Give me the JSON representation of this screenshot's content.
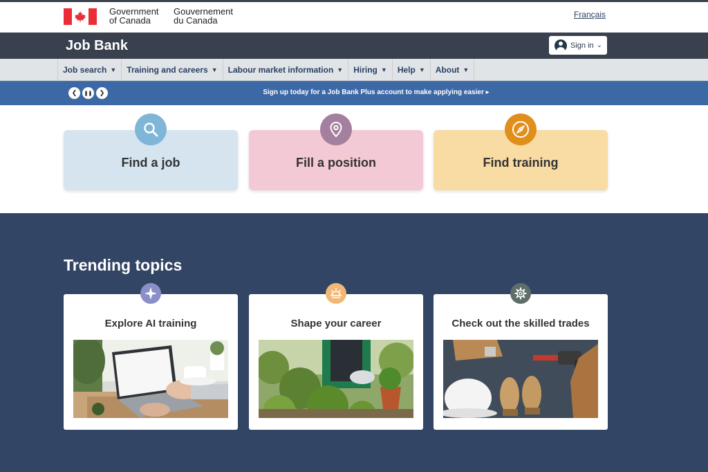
{
  "gc_header": {
    "signature_en_line1": "Government",
    "signature_en_line2": "of Canada",
    "signature_fr_line1": "Gouvernement",
    "signature_fr_line2": "du Canada",
    "language_toggle": "Français"
  },
  "app_bar": {
    "title": "Job Bank",
    "sign_in_label": "Sign in"
  },
  "menu": {
    "items": [
      {
        "label": "Job search"
      },
      {
        "label": "Training and careers"
      },
      {
        "label": "Labour market information"
      },
      {
        "label": "Hiring"
      },
      {
        "label": "Help"
      },
      {
        "label": "About"
      }
    ]
  },
  "promo": {
    "message": "Sign up today for a Job Bank Plus account to make applying easier"
  },
  "hero_cards": [
    {
      "label": "Find a job",
      "icon": "search-icon",
      "color": "#d5e4ef"
    },
    {
      "label": "Fill a position",
      "icon": "location-pin-icon",
      "color": "#f4c9d6"
    },
    {
      "label": "Find training",
      "icon": "compass-icon",
      "color": "#f9dba4"
    }
  ],
  "trending": {
    "title": "Trending topics",
    "cards": [
      {
        "title": "Explore AI training",
        "icon": "sparkle-icon"
      },
      {
        "title": "Shape your career",
        "icon": "sunrise-icon"
      },
      {
        "title": "Check out the skilled trades",
        "icon": "gear-icon"
      }
    ]
  },
  "colors": {
    "app_bar": "#38414d",
    "promo_bar": "#3c69a5",
    "trending_bg": "#334564",
    "link": "#284162"
  }
}
